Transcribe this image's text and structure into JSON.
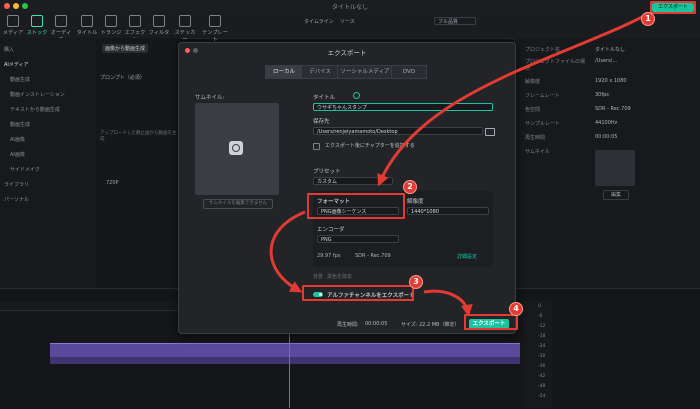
{
  "window": {
    "title": "タイトルなし"
  },
  "toolbar": {
    "tools": [
      {
        "label": "メディア",
        "active": false
      },
      {
        "label": "ストック",
        "active": true
      },
      {
        "label": "オーディオ",
        "active": false
      },
      {
        "label": "タイトル",
        "active": false
      },
      {
        "label": "トランジ",
        "active": false
      },
      {
        "label": "エフェクト",
        "active": false
      },
      {
        "label": "フィルター",
        "active": false
      },
      {
        "label": "ステッカー",
        "active": false
      },
      {
        "label": "テンプレート",
        "active": false
      }
    ],
    "player_tabs": [
      "タイムライン",
      "ソース"
    ],
    "quality": "フル品質",
    "export_label": "エクスポート"
  },
  "sidebar": {
    "items": [
      {
        "label": "購入",
        "selected": false
      },
      {
        "label": "AIメディア",
        "selected": true
      },
      {
        "label": "動画生成",
        "selected": false
      },
      {
        "label": "動画インストレーション",
        "selected": false
      },
      {
        "label": "テキストから動画生成",
        "selected": false
      },
      {
        "label": "動画生成",
        "selected": false
      },
      {
        "label": "AI画像",
        "selected": false
      },
      {
        "label": "AI画像",
        "selected": false
      },
      {
        "label": "サイドメイク",
        "selected": false
      },
      {
        "label": "ライブラリ",
        "selected": false
      },
      {
        "label": "パーソナル",
        "selected": false
      }
    ]
  },
  "library": {
    "tab": "画像から動画生成",
    "prompt_label": "プロンプト（必須）",
    "upload_hint": "アップロードした静止画から動画を生成",
    "resolution": "720P"
  },
  "right_panel": {
    "rows": [
      {
        "label": "プロジェクト名",
        "value": "タイトルなし"
      },
      {
        "label": "プロジェクトファイルの場所",
        "value": "/Users/..."
      },
      {
        "label": "解像度",
        "value": "1920 x 1080"
      },
      {
        "label": "フレームレート",
        "value": "30fps"
      },
      {
        "label": "色空間",
        "value": "SDR - Rec.709"
      },
      {
        "label": "サンプルレート",
        "value": "44100Hz"
      },
      {
        "label": "再生時間",
        "value": "00:00:05"
      }
    ],
    "thumbnail_label": "サムネイル",
    "thumbnail_button": "編集"
  },
  "modal": {
    "title": "エクスポート",
    "tabs": [
      {
        "label": "ローカル",
        "selected": true
      },
      {
        "label": "デバイス",
        "selected": false
      },
      {
        "label": "ソーシャルメディア",
        "selected": false
      },
      {
        "label": "DVD",
        "selected": false
      }
    ],
    "thumbnail_label": "サムネイル:",
    "thumbnail_button": "サムネイルを編集できません",
    "name_label": "タイトル",
    "name_value": "ウサギちゃんスタンプ",
    "save_label": "保存先",
    "save_value": "/Users/renjeiyamamoto/Desktop",
    "chapter_label": "エクスポート後にチャプターを追加する",
    "preset_label": "プリセット",
    "preset_value": "カスタム",
    "format_label": "フォーマット",
    "format_value": "PNG画像シーケンス",
    "resolution_label": "解像度",
    "resolution_value": "1440*1080",
    "encoder_label": "エンコーダ",
    "encoder_value": "PNG",
    "framerate_value": "29.97 fps",
    "colorspace_value": "SDR - Rec.709",
    "detail_link": "詳細設定",
    "bg_label": "背景",
    "bg_value": "黒色を除去",
    "alpha_label": "アルファチャンネルをエクスポート",
    "duration_label": "再生時間:",
    "duration_value": "00:00:05",
    "size_label": "サイズ:",
    "size_value": "22.2 MB（推定）",
    "export_button": "エクスポート"
  },
  "steps": [
    "1",
    "2",
    "3",
    "4"
  ],
  "level_meter": [
    "0",
    "-6",
    "-12",
    "-18",
    "-24",
    "-30",
    "-36",
    "-42",
    "-48",
    "-54"
  ]
}
